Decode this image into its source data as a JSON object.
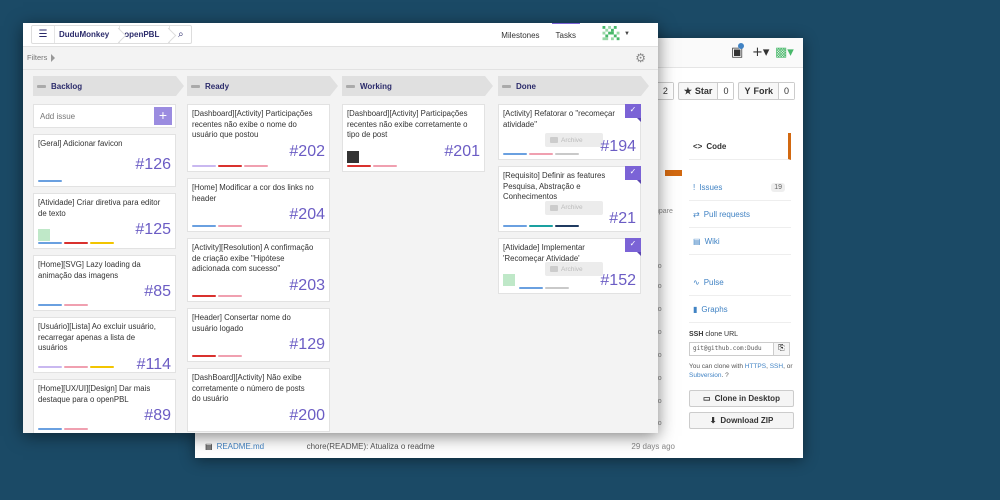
{
  "github": {
    "star_label": "Star",
    "star_count": "0",
    "fork_label": "Fork",
    "fork_count": "0",
    "watch_count": "2",
    "nav": [
      {
        "label": "Code",
        "icon": "<>"
      },
      {
        "label": "Issues",
        "badge": "19",
        "icon": "!"
      },
      {
        "label": "Pull requests",
        "icon": "⇄"
      },
      {
        "label": "Wiki",
        "icon": "▤"
      },
      {
        "label": "Pulse",
        "icon": "∿"
      },
      {
        "label": "Graphs",
        "icon": "▮"
      }
    ],
    "ssh_title": "SSH",
    "ssh_suffix": "clone URL",
    "ssh_url": "git@github.com:Dudu",
    "clone_note_prefix": "You can clone with",
    "clone_https": "HTTPS",
    "clone_ssh": "SSH",
    "clone_or": "or",
    "clone_subversion": "Subversion",
    "clone_desktop": "Clone in Desktop",
    "download_zip": "Download ZIP",
    "compare_label": "mpare",
    "ago_labels": [
      "ago",
      "ago",
      "ago",
      "ago",
      "ago",
      "ago",
      "ago",
      "ago",
      "ago",
      "ago"
    ],
    "readme": {
      "name": "README.md",
      "message": "chore(README): Atualiza o readme",
      "age": "29 days ago"
    }
  },
  "app": {
    "crumb_user": "DuduMonkey",
    "crumb_repo": "openPBL",
    "tab_milestones": "Milestones",
    "tab_tasks": "Tasks",
    "filters_label": "Filters",
    "add_issue_placeholder": "Add issue"
  },
  "columns": [
    {
      "name": "Backlog",
      "cards": [
        {
          "title": "[Geral] Adicionar favicon",
          "number": "#126",
          "labels": [
            "blue"
          ]
        },
        {
          "title": "[Atividade] Criar diretiva para editor de texto",
          "number": "#125",
          "labels": [
            "blue",
            "red",
            "yellow"
          ],
          "avatar": true
        },
        {
          "title": "[Home][SVG] Lazy loading da animação das imagens",
          "number": "#85",
          "labels": [
            "blue",
            "pink"
          ]
        },
        {
          "title": "[Usuário][Lista] Ao excluir usuário, recarregar apenas a lista de usuários",
          "number": "#114",
          "labels": [
            "lav",
            "pink",
            "yellow"
          ]
        },
        {
          "title": "[Home][UX/UI][Design] Dar mais destaque para o openPBL",
          "number": "#89",
          "labels": [
            "blue",
            "pink"
          ]
        }
      ]
    },
    {
      "name": "Ready",
      "cards": [
        {
          "title": "[Dashboard][Activity] Participações recentes não exibe o nome do usuário que postou",
          "number": "#202",
          "labels": [
            "lav",
            "red",
            "pink"
          ]
        },
        {
          "title": "[Home] Modificar a cor dos links no header",
          "number": "#204",
          "labels": [
            "blue",
            "pink"
          ]
        },
        {
          "title": "[Activity][Resolution] A confirmação de criação exibe \"Hipótese adicionada com sucesso\"",
          "number": "#203",
          "labels": [
            "red",
            "pink"
          ]
        },
        {
          "title": "[Header] Consertar nome do usuário logado",
          "number": "#129",
          "labels": [
            "red",
            "pink"
          ]
        },
        {
          "title": "[DashBoard][Activity] Não exibe corretamente o número de posts do usuário",
          "number": "#200",
          "labels": []
        }
      ]
    },
    {
      "name": "Working",
      "cards": [
        {
          "title": "[Dashboard][Activity] Participações recentes não exibe corretamente o tipo de post",
          "number": "#201",
          "labels": [
            "red",
            "pink"
          ],
          "avatar": true
        }
      ]
    },
    {
      "name": "Done",
      "cards": [
        {
          "title": "[Activity] Refatorar o \"recomeçar atividade\"",
          "number": "#194",
          "labels": [
            "blue",
            "pink",
            "gray"
          ],
          "archive": "Archive"
        },
        {
          "title": "[Requisito] Definir as features Pesquisa, Abstração e Conhecimentos",
          "number": "#21",
          "labels": [
            "blue",
            "teal",
            "navy"
          ],
          "archive": "Archive"
        },
        {
          "title": "[Atividade] Implementar 'Recomeçar Atividade'",
          "number": "#152",
          "labels": [
            "blue",
            "gray"
          ],
          "archive": "Archive",
          "avatar": true
        }
      ]
    }
  ],
  "colors": {
    "accent": "#7b63d6",
    "number": "#6b5cc4",
    "background": "#1b4a66",
    "github_orange": "#d26911",
    "link": "#4183c4"
  },
  "icons": [
    "menu-icon",
    "search-icon",
    "gear-icon",
    "plus-icon",
    "check-icon",
    "archive-icon",
    "star-icon",
    "fork-icon",
    "bell-icon",
    "avatar"
  ]
}
